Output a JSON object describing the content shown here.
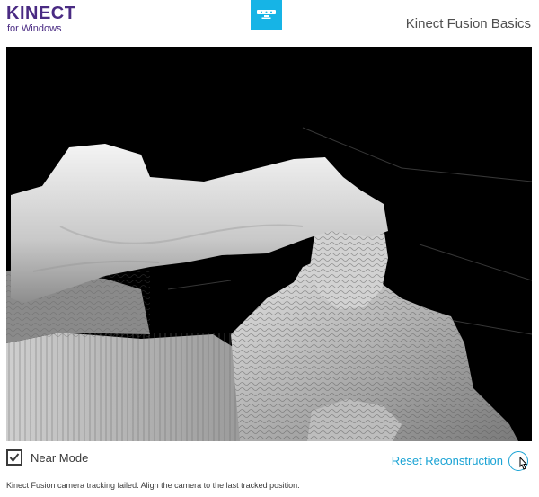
{
  "header": {
    "logo_main": "KINECT",
    "logo_sub": "for Windows",
    "app_title": "Kinect Fusion Basics",
    "brand_color": "#4a2b83",
    "accent_color": "#16b4e6",
    "sensor_icon": "kinect-sensor-icon"
  },
  "viewport": {
    "content": "depth-reconstruction-render"
  },
  "controls": {
    "near_mode_label": "Near Mode",
    "near_mode_checked": true,
    "reset_label": "Reset Reconstruction",
    "reset_icon": "reset-circle-icon"
  },
  "status": {
    "message": "Kinect Fusion camera tracking failed. Align the camera to the last tracked position."
  }
}
